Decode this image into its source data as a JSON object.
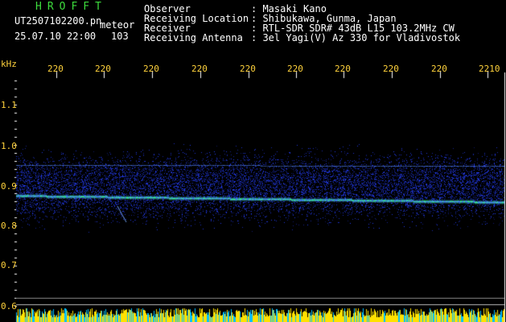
{
  "header": {
    "brand": "HROFFT",
    "filename": "UT2507102200.pn",
    "meteor_label": "meteor",
    "datetime": "25.07.10 22:00",
    "count": "103",
    "fields": [
      {
        "label": "Observer",
        "value": ": Masaki Kano"
      },
      {
        "label": "Receiving Location",
        "value": ": Shibukawa, Gunma, Japan"
      },
      {
        "label": "Receiver",
        "value": ": RTL-SDR SDR# 43dB L15 103.2MHz CW"
      },
      {
        "label": "Receiving Antenna",
        "value": ": 3el Yagi(V) Az 330 for Vladivostok"
      }
    ]
  },
  "axes": {
    "y_unit": "kHz",
    "y_ticks": [
      "1.1",
      "1.0",
      "0.9",
      "0.8",
      "0.7",
      "0.6"
    ],
    "x_ticks": [
      "220",
      "220",
      "220",
      "220",
      "220",
      "220",
      "220",
      "220",
      "220",
      "2210"
    ]
  },
  "colors": {
    "background": "#000000",
    "text": "#ffffff",
    "brand": "#3ddc3d",
    "tick": "#ffd23c",
    "signal_band": "#1a2bff",
    "carrier": "#3cff9a",
    "bottom_bar": "#ffe100"
  }
}
